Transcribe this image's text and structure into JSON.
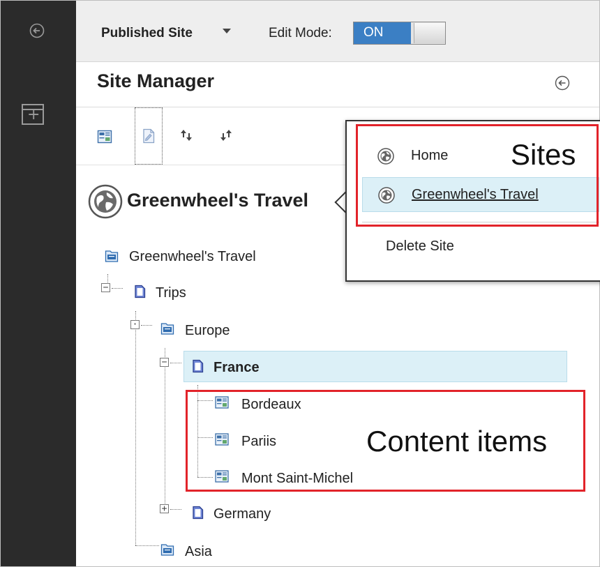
{
  "topbar": {
    "site_selector_label": "Published Site",
    "edit_mode_label": "Edit Mode:",
    "edit_mode_state": "ON"
  },
  "site_manager": {
    "title": "Site Manager",
    "current_site_name": "Greenwheel's Travel"
  },
  "tree": {
    "root": "Greenwheel's Travel",
    "trips": "Trips",
    "europe": "Europe",
    "france": "France",
    "bordeaux": "Bordeaux",
    "pariis": "Pariis",
    "mont_saint_michel": "Mont Saint-Michel",
    "germany": "Germany",
    "asia": "Asia"
  },
  "site_menu": {
    "items": [
      {
        "label": "Home",
        "selected": false
      },
      {
        "label": "Greenwheel's Travel",
        "selected": true
      }
    ],
    "delete_label": "Delete Site"
  },
  "annotations": {
    "sites": "Sites",
    "content_items": "Content items"
  },
  "colors": {
    "rail": "#2b2b2b",
    "toggle_on": "#3b7fc4",
    "selection": "#dcf0f7",
    "annotation_red": "#e2232a"
  },
  "icons": {
    "rail_back": "back-arrow-icon",
    "rail_add": "add-panel-icon",
    "toolbar": [
      "content-item-icon",
      "page-icon",
      "move-up-icon",
      "move-down-icon"
    ],
    "site": "globe-icon"
  }
}
